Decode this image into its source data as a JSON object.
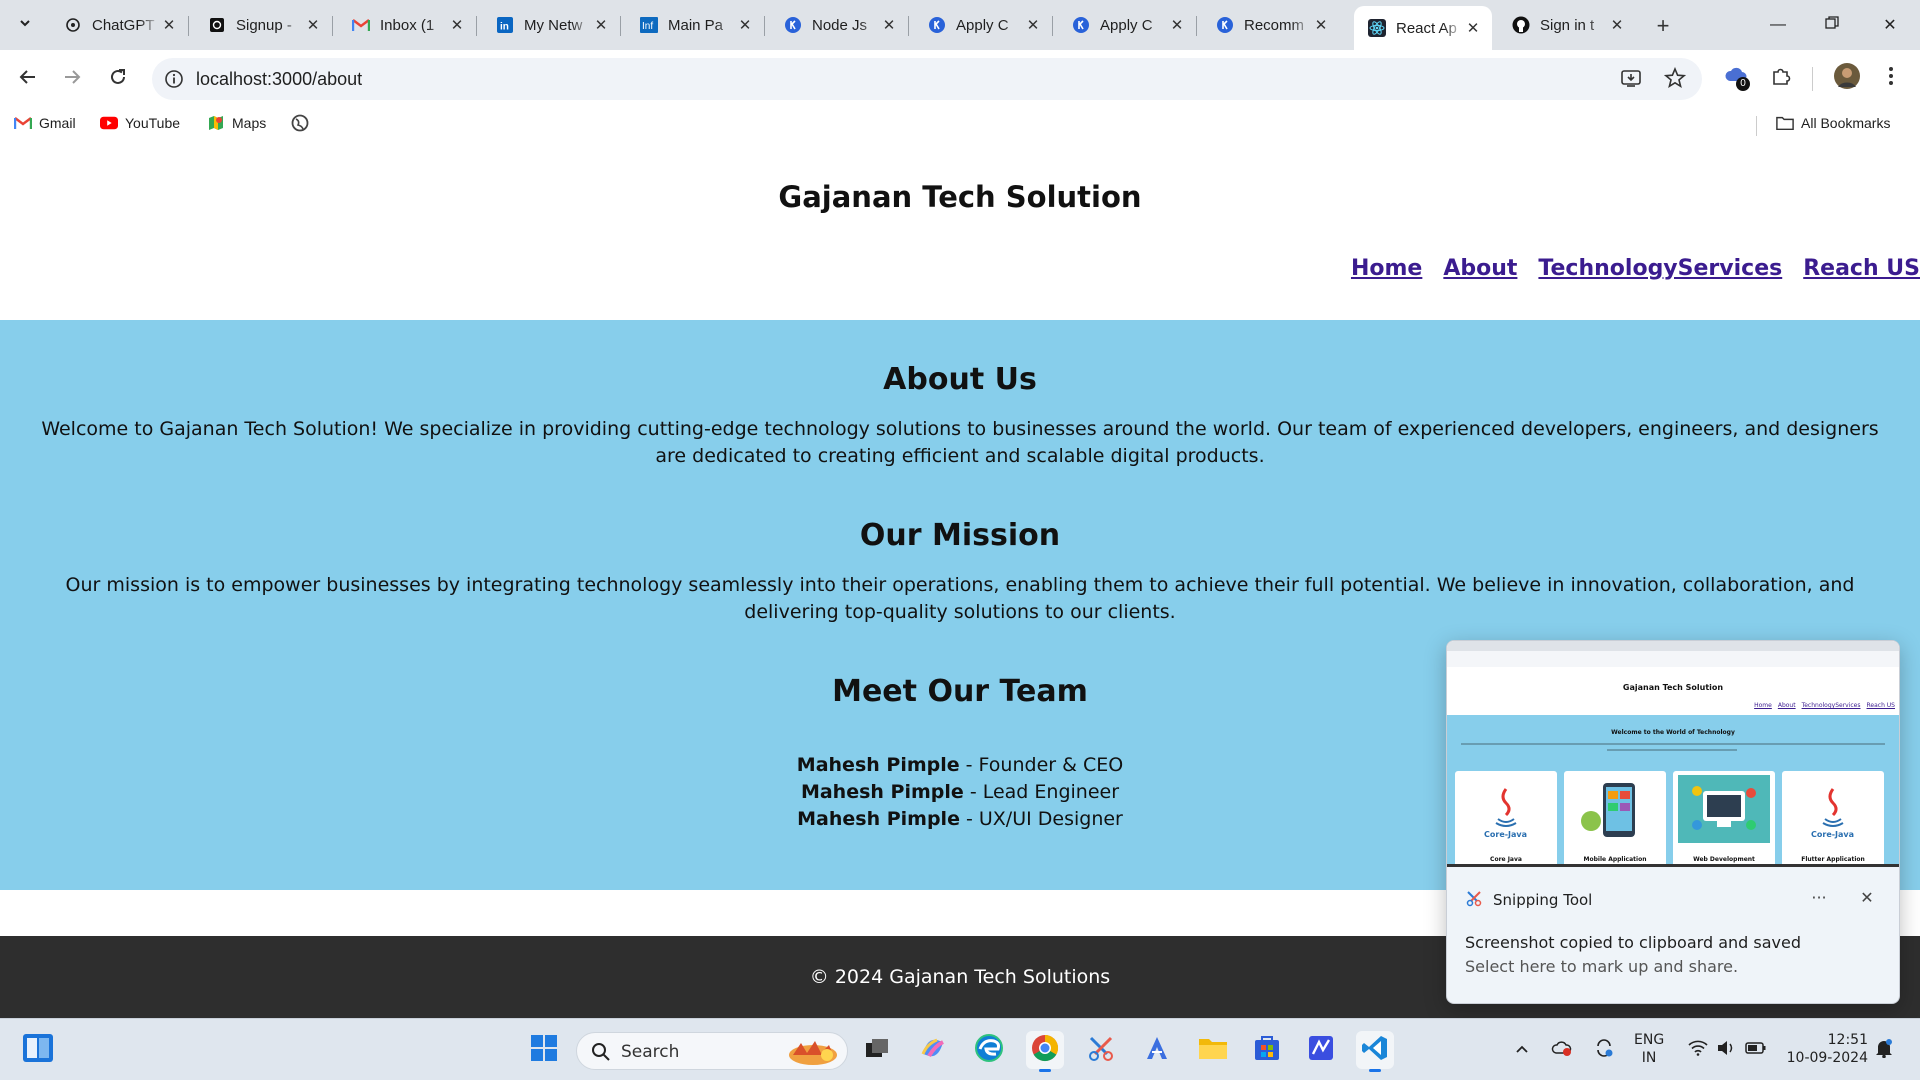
{
  "browser": {
    "tabs": [
      {
        "title": "ChatGPT",
        "icon": "chatgpt-icon"
      },
      {
        "title": "Signup -",
        "icon": "openai-icon"
      },
      {
        "title": "Inbox (1",
        "icon": "gmail-icon"
      },
      {
        "title": "My Netw",
        "icon": "linkedin-icon"
      },
      {
        "title": "Main Pa",
        "icon": "info-icon"
      },
      {
        "title": "Node Js",
        "icon": "k-icon"
      },
      {
        "title": "Apply C",
        "icon": "k-icon"
      },
      {
        "title": "Apply C",
        "icon": "k-icon"
      },
      {
        "title": "Recomm",
        "icon": "k-icon"
      },
      {
        "title": "React Ap",
        "icon": "react-icon",
        "active": true
      },
      {
        "title": "Sign in t",
        "icon": "github-icon"
      }
    ],
    "url": "localhost:3000/about",
    "extension_badge": "0",
    "bookmarks": [
      {
        "label": "Gmail",
        "icon": "gmail-icon"
      },
      {
        "label": "YouTube",
        "icon": "youtube-icon"
      },
      {
        "label": "Maps",
        "icon": "maps-icon"
      }
    ],
    "all_bookmarks": "All Bookmarks"
  },
  "site": {
    "title": "Gajanan Tech Solution",
    "nav": [
      "Home",
      "About",
      "TechnologyServices",
      "Reach US"
    ],
    "about": {
      "heading": "About Us",
      "text": "Welcome to Gajanan Tech Solution! We specialize in providing cutting-edge technology solutions to businesses around the world. Our team of experienced developers, engineers, and designers are dedicated to creating efficient and scalable digital products.",
      "mission_heading": "Our Mission",
      "mission_text": "Our mission is to empower businesses by integrating technology seamlessly into their operations, enabling them to achieve their full potential. We believe in innovation, collaboration, and delivering top-quality solutions to our clients.",
      "team_heading": "Meet Our Team",
      "team": [
        {
          "name": "Mahesh Pimple",
          "role": " - Founder & CEO"
        },
        {
          "name": "Mahesh Pimple",
          "role": " - Lead Engineer"
        },
        {
          "name": "Mahesh Pimple",
          "role": " - UX/UI Designer"
        }
      ]
    },
    "footer": "© 2024 Gajanan Tech Solutions",
    "colors": {
      "section_bg": "#87ceeb",
      "footer_bg": "#2e2e2e",
      "link": "#3b1c8f"
    }
  },
  "toast": {
    "app": "Snipping Tool",
    "message": "Screenshot copied to clipboard and saved",
    "sub": "Select here to mark up and share.",
    "thumbnail": {
      "title": "Gajanan Tech Solution",
      "nav": [
        "Home",
        "About",
        "TechnologyServices",
        "Reach US"
      ],
      "welcome": "Welcome to the World of Technology",
      "cards": [
        "Core Java",
        "Mobile Application",
        "Web Development",
        "Flutter Application"
      ],
      "card_badges": [
        "Core-Java",
        "",
        "",
        "Core-Java"
      ]
    }
  },
  "taskbar": {
    "search_label": "Search",
    "language": "ENG",
    "region": "IN",
    "time": "12:51",
    "date": "10-09-2024"
  }
}
